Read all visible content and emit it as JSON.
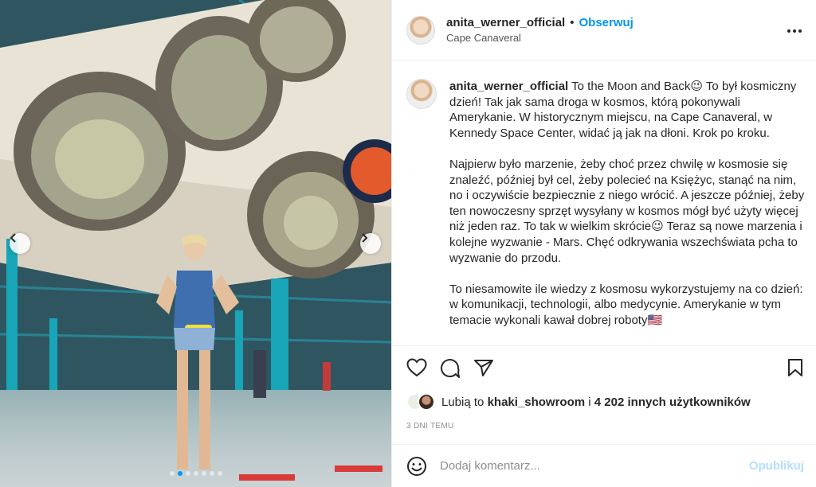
{
  "post": {
    "username": "anita_werner_official",
    "separator": "•",
    "follow_label": "Obserwuj",
    "location": "Cape Canaveral",
    "more_icon": "more-horizontal-icon"
  },
  "caption": {
    "username": "anita_werner_official",
    "text": "To the Moon and Back😉 To był kosmiczny dzień! Tak jak sama droga w kosmos, którą pokonywali Amerykanie. W historycznym miejscu, na Cape Canaveral, w Kennedy Space Center, widać ją jak na dłoni. Krok po kroku.\n\nNajpierw było marzenie, żeby choć przez chwilę w kosmosie się znaleźć, później był cel, żeby polecieć na Księżyc, stanąć na nim, no i oczywiście bezpiecznie z niego wrócić. A jeszcze później, żeby ten nowoczesny sprzęt wysyłany w kosmos mógł być użyty więcej niż jeden raz. To tak w wielkim skrócie😉 Teraz są nowe marzenia i kolejne wyzwanie - Mars. Chęć odkrywania wszechświata pcha to wyzwanie do przodu.\n\nTo niesamowite ile wiedzy z kosmosu wykorzystujemy na co dzień: w komunikacji, technologii, albo medycynie. Amerykanie w tym temacie wykonali kawał dobrej roboty🇺🇸"
  },
  "likes": {
    "prefix": "Lubią to",
    "user": "khaki_showroom",
    "connector": "i",
    "count_text": "4 202 innych użytkowników"
  },
  "timestamp": "3 DNI TEMU",
  "comment": {
    "placeholder": "Dodaj komentarz...",
    "post_label": "Opublikuj"
  },
  "carousel": {
    "slide_count": 7,
    "active_index": 1
  },
  "icons": {
    "like": "heart-icon",
    "comment": "comment-icon",
    "share": "send-icon",
    "save": "bookmark-icon",
    "emoji": "emoji-icon",
    "prev": "chevron-left-icon",
    "next": "chevron-right-icon"
  },
  "colors": {
    "accent": "#0095f6",
    "post_disabled": "#b2dffc",
    "muted": "#8e8e8e",
    "text": "#262626"
  }
}
